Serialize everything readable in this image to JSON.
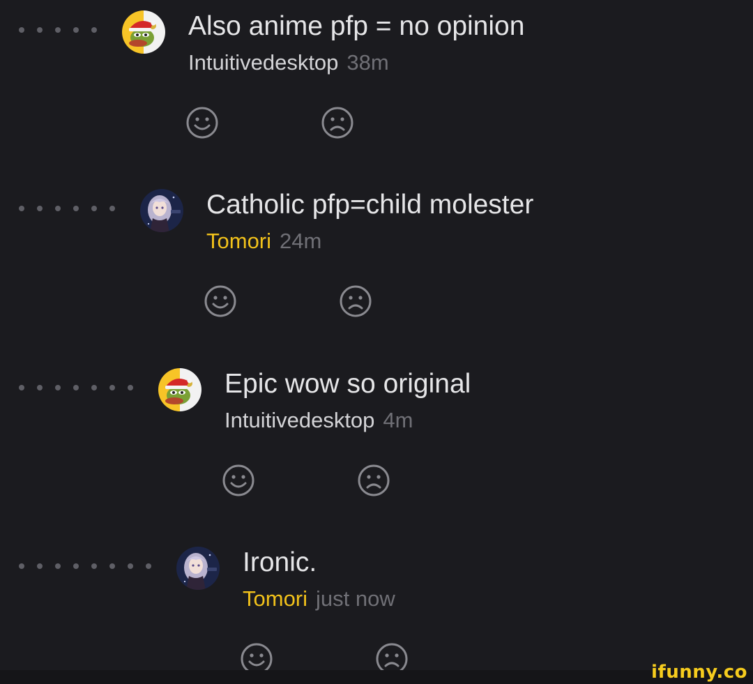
{
  "comments": [
    {
      "depth": 5,
      "avatar": "pepe-santa-hat-avatar",
      "text": "Also anime pfp = no opinion",
      "author": "Intuitivedesktop",
      "author_color": "#d4d4d7",
      "time": "38m"
    },
    {
      "depth": 6,
      "avatar": "anime-girl-avatar",
      "text": "Catholic pfp=child molester",
      "author": "Tomori",
      "author_color": "#f2c21b",
      "time": "24m"
    },
    {
      "depth": 7,
      "avatar": "pepe-santa-hat-avatar",
      "text": "Epic wow so original",
      "author": "Intuitivedesktop",
      "author_color": "#d4d4d7",
      "time": "4m"
    },
    {
      "depth": 8,
      "avatar": "anime-girl-avatar",
      "text": "Ironic.",
      "author": "Tomori",
      "author_color": "#f2c21b",
      "time": "just now"
    }
  ],
  "reactions": {
    "smile_icon": "smile-icon",
    "frown_icon": "frown-icon"
  },
  "colors": {
    "background": "#1b1b1f",
    "thread_dot": "#5f5f66",
    "reaction_icon": "#8a8a90",
    "watermark": "#f6cc1e"
  },
  "watermark": "ifunny.co"
}
